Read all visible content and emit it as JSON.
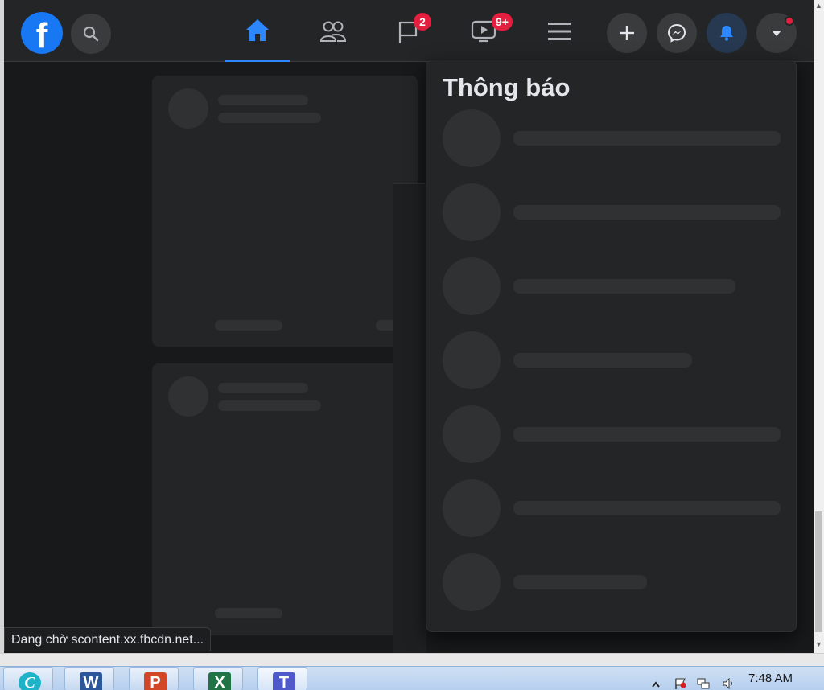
{
  "nav": {
    "notifications_badge": "2",
    "watch_badge": "9+"
  },
  "notifications": {
    "title": "Thông báo"
  },
  "status_bar": {
    "text": "Đang chờ scontent.xx.fbcdn.net..."
  },
  "taskbar": {
    "clock": "7:48 AM",
    "apps": [
      "canva",
      "word",
      "powerpoint",
      "excel",
      "teams"
    ]
  },
  "colors": {
    "brand": "#1877f2",
    "badge": "#e41e3f",
    "active_tab": "#2d88ff",
    "panel_bg": "#242526",
    "page_bg": "#18191a"
  }
}
